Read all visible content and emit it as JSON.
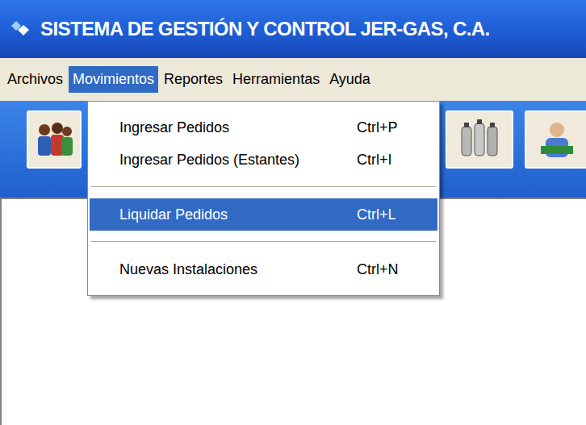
{
  "window": {
    "title": "SISTEMA DE GESTIÓN Y CONTROL JER-GAS, C.A."
  },
  "menubar": {
    "items": [
      {
        "label": "Archivos",
        "selected": false
      },
      {
        "label": "Movimientos",
        "selected": true
      },
      {
        "label": "Reportes",
        "selected": false
      },
      {
        "label": "Herramientas",
        "selected": false
      },
      {
        "label": "Ayuda",
        "selected": false
      }
    ]
  },
  "dropdown": {
    "items": [
      {
        "kind": "item",
        "label": "Ingresar Pedidos",
        "shortcut": "Ctrl+P",
        "selected": false
      },
      {
        "kind": "item",
        "label": "Ingresar Pedidos (Estantes)",
        "shortcut": "Ctrl+I",
        "selected": false
      },
      {
        "kind": "separator"
      },
      {
        "kind": "item",
        "label": "Liquidar Pedidos",
        "shortcut": "Ctrl+L",
        "selected": true
      },
      {
        "kind": "separator"
      },
      {
        "kind": "item",
        "label": "Nuevas Instalaciones",
        "shortcut": "Ctrl+N",
        "selected": false
      }
    ]
  }
}
